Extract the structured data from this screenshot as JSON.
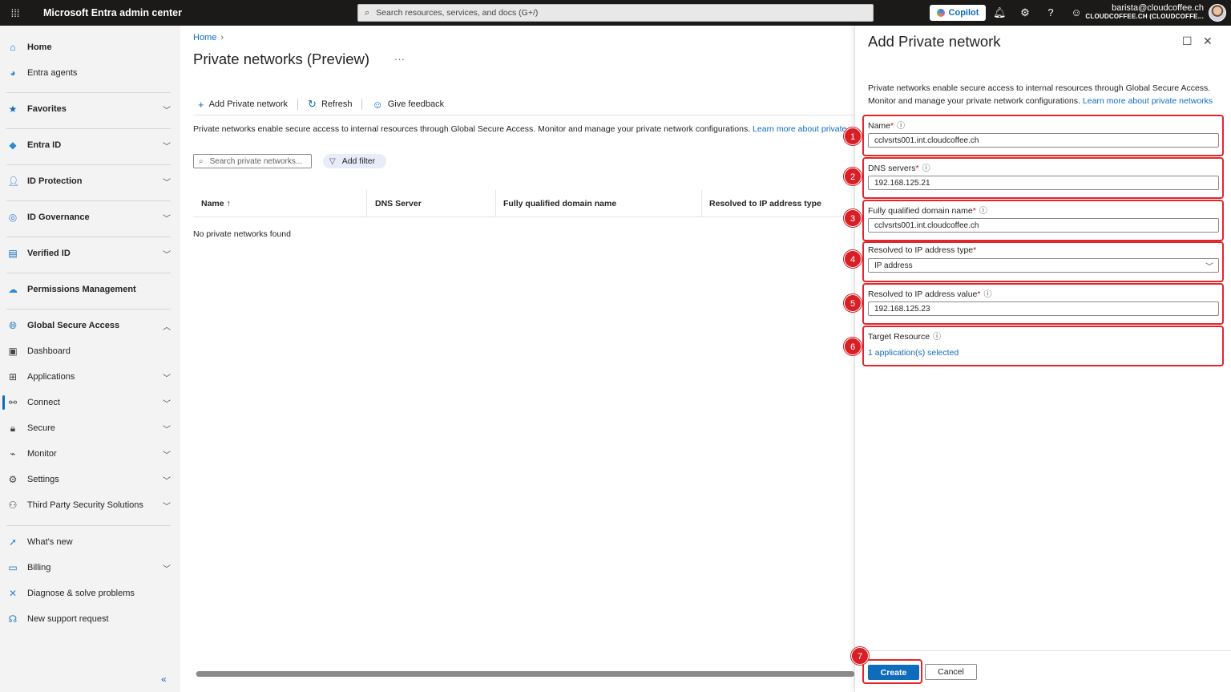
{
  "topbar": {
    "app_title": "Microsoft Entra admin center",
    "search_placeholder": "Search resources, services, and docs (G+/)",
    "copilot_label": "Copilot",
    "account_email": "barista@cloudcoffee.ch",
    "account_tenant": "CLOUDCOFFEE.CH (CLOUDCOFFE..."
  },
  "sidebar": {
    "home": "Home",
    "entra_agents": "Entra agents",
    "favorites": "Favorites",
    "entra_id": "Entra ID",
    "id_protection": "ID Protection",
    "id_governance": "ID Governance",
    "verified_id": "Verified ID",
    "permissions_management": "Permissions Management",
    "global_secure_access": "Global Secure Access",
    "dashboard": "Dashboard",
    "applications": "Applications",
    "connect": "Connect",
    "secure": "Secure",
    "monitor": "Monitor",
    "settings": "Settings",
    "third_party": "Third Party Security Solutions",
    "whats_new": "What's new",
    "billing": "Billing",
    "diagnose": "Diagnose & solve problems",
    "support": "New support request",
    "collapse_glyph": "«"
  },
  "main": {
    "breadcrumb_home": "Home",
    "title": "Private networks (Preview)",
    "toolbar": {
      "add": "Add Private network",
      "refresh": "Refresh",
      "feedback": "Give feedback"
    },
    "description": "Private networks enable secure access to internal resources through Global Secure Access. Monitor and manage your private network configurations.",
    "description_link": "Learn more about private networks",
    "search_placeholder": "Search private networks...",
    "add_filter": "Add filter",
    "columns": [
      "Name ↑",
      "DNS Server",
      "Fully qualified domain name",
      "Resolved to IP address type"
    ],
    "empty_message": "No private networks found"
  },
  "panel": {
    "title": "Add Private network",
    "description": "Private networks enable secure access to internal resources through Global Secure Access. Monitor and manage your private network configurations.",
    "description_link": "Learn more about private networks",
    "fields": {
      "name_label": "Name",
      "name_value": "cclvsrts001.int.cloudcoffee.ch",
      "dns_label": "DNS servers",
      "dns_value": "192.168.125.21",
      "fqdn_label": "Fully qualified domain name",
      "fqdn_value": "cclvsrts001.int.cloudcoffee.ch",
      "ip_type_label": "Resolved to IP address type",
      "ip_type_value": "IP address",
      "ip_value_label": "Resolved to IP address value",
      "ip_value_value": "192.168.125.23",
      "target_label": "Target Resource",
      "target_link": "1 application(s) selected"
    },
    "required_mark": "*",
    "create": "Create",
    "cancel": "Cancel",
    "badges": [
      "1",
      "2",
      "3",
      "4",
      "5",
      "6",
      "7"
    ]
  },
  "colors": {
    "accent": "#0f6cbd",
    "topbar": "#1b1a19",
    "annotation_red": "#e3262a",
    "sidebar_bg": "#f3f3f3"
  }
}
